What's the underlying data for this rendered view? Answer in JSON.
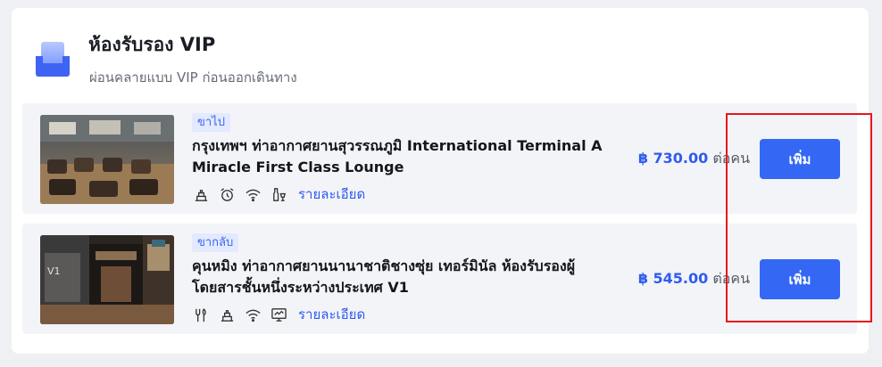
{
  "section": {
    "title": "ห้องรับรอง VIP",
    "subtitle": "ผ่อนคลายแบบ VIP ก่อนออกเดินทาง",
    "icon": "lounge-sofa-icon"
  },
  "lounges": [
    {
      "badge": "ขาไป",
      "name": "กรุงเทพฯ ท่าอากาศยานสุวรรณภูมิ International Terminal A Miracle First Class Lounge",
      "amenities": [
        "food-tray-icon",
        "alarm-clock-icon",
        "wifi-icon",
        "drinks-icon"
      ],
      "details_label": "รายละเอียด",
      "price": "฿ 730.00",
      "per_unit": "ต่อคน",
      "add_label": "เพิ่ม",
      "image": "lounge-photo"
    },
    {
      "badge": "ขากลับ",
      "name": "คุนหมิง ท่าอากาศยานนานาชาติชางซุ่ย เทอร์มินัล ห้องรับรองผู้โดยสารชั้นหนึ่งระหว่างประเทศ V1",
      "amenities": [
        "utensils-icon",
        "food-tray-icon",
        "wifi-icon",
        "tv-icon"
      ],
      "details_label": "รายละเอียด",
      "price": "฿ 545.00",
      "per_unit": "ต่อคน",
      "add_label": "เพิ่ม",
      "image": "lounge-photo"
    }
  ],
  "colors": {
    "accent": "#3468f4",
    "price": "#2f5bef",
    "badge_bg": "#e3e9ff",
    "row_bg": "#f3f4f8",
    "highlight": "#e8161c"
  }
}
